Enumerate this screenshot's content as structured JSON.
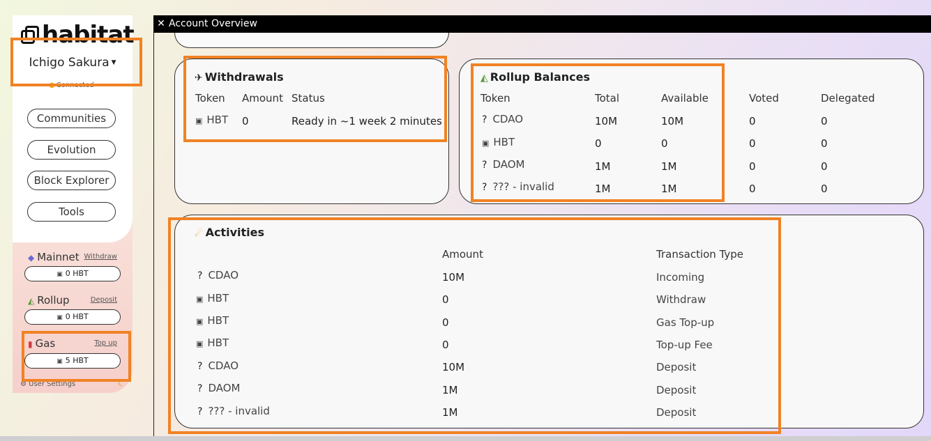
{
  "app": {
    "logo_text": "habitat",
    "user_name": "Ichigo Sakura",
    "connected_label": "Connected"
  },
  "sidebar": {
    "nav": [
      "Communities",
      "Evolution",
      "Block Explorer",
      "Tools"
    ],
    "networks": [
      {
        "name": "Mainnet",
        "link": "Withdraw",
        "balance": "0 HBT",
        "icon": "ethereum-icon"
      },
      {
        "name": "Rollup",
        "link": "Deposit",
        "balance": "0 HBT",
        "icon": "rollup-icon"
      },
      {
        "name": "Gas",
        "link": "Top up",
        "balance": "5 HBT",
        "icon": "fuel-icon"
      }
    ],
    "settings_label": "User Settings"
  },
  "window": {
    "title": "Account Overview"
  },
  "withdrawals": {
    "title": "Withdrawals",
    "headers": [
      "Token",
      "Amount",
      "Status"
    ],
    "rows": [
      {
        "token": "HBT",
        "amount": "0",
        "status": "Ready in ~1 week 2 minutes"
      }
    ]
  },
  "rollup_balances": {
    "title": "Rollup Balances",
    "headers": [
      "Token",
      "Total",
      "Available",
      "Voted",
      "Delegated"
    ],
    "rows": [
      {
        "icon": "?",
        "token": "CDAO",
        "total": "10M",
        "available": "10M",
        "voted": "0",
        "delegated": "0"
      },
      {
        "icon": "hbt",
        "token": "HBT",
        "total": "0",
        "available": "0",
        "voted": "0",
        "delegated": "0"
      },
      {
        "icon": "?",
        "token": "DAOM",
        "total": "1M",
        "available": "1M",
        "voted": "0",
        "delegated": "0"
      },
      {
        "icon": "?",
        "token": "??? - invalid",
        "total": "1M",
        "available": "1M",
        "voted": "0",
        "delegated": "0"
      }
    ]
  },
  "activities": {
    "title": "Activities",
    "headers": [
      "Amount",
      "Transaction Type"
    ],
    "rows": [
      {
        "icon": "?",
        "token": "CDAO",
        "amount": "10M",
        "type": "Incoming"
      },
      {
        "icon": "hbt",
        "token": "HBT",
        "amount": "0",
        "type": "Withdraw"
      },
      {
        "icon": "hbt",
        "token": "HBT",
        "amount": "0",
        "type": "Gas Top-up"
      },
      {
        "icon": "hbt",
        "token": "HBT",
        "amount": "0",
        "type": "Top-up Fee"
      },
      {
        "icon": "?",
        "token": "CDAO",
        "amount": "10M",
        "type": "Deposit"
      },
      {
        "icon": "?",
        "token": "DAOM",
        "amount": "1M",
        "type": "Deposit"
      },
      {
        "icon": "?",
        "token": "??? - invalid",
        "amount": "1M",
        "type": "Deposit"
      }
    ]
  },
  "colors": {
    "highlight": "#f08224",
    "titlebar": "#000000"
  }
}
